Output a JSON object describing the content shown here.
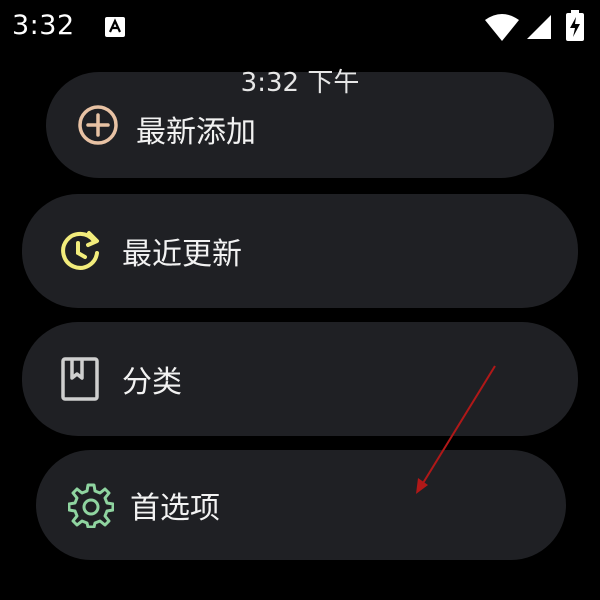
{
  "status_bar": {
    "time": "3:32",
    "icons": [
      "notification-a-icon",
      "wifi-icon",
      "signal-icon",
      "battery-charging-icon"
    ]
  },
  "watch": {
    "time": "3:32 下午"
  },
  "menu": {
    "items": [
      {
        "label": "最新添加",
        "icon": "add-circle-icon",
        "icon_color": "#e8c2a4"
      },
      {
        "label": "最近更新",
        "icon": "history-icon",
        "icon_color": "#f2ec7c"
      },
      {
        "label": "分类",
        "icon": "bookmark-book-icon",
        "icon_color": "#cfcfcf"
      },
      {
        "label": "首选项",
        "icon": "gear-icon",
        "icon_color": "#8fd4a0"
      }
    ]
  },
  "colors": {
    "background": "#000000",
    "pill": "#1f2024",
    "text": "#f2f2f2",
    "annotation": "#b01818"
  }
}
